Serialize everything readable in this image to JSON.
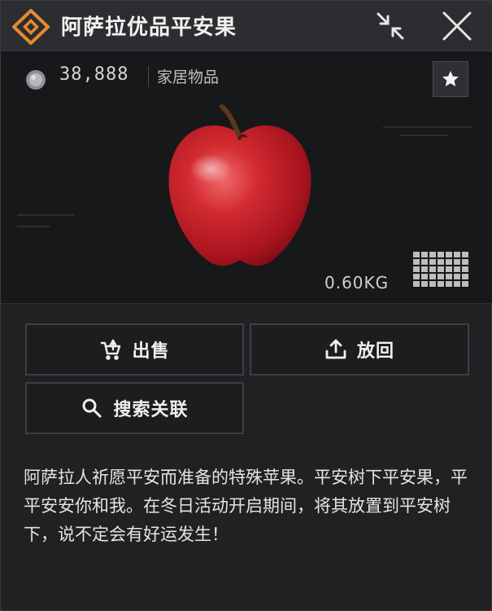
{
  "header": {
    "title": "阿萨拉优品平安果",
    "collapse_icon": "collapse-arrows-icon",
    "close_icon": "close-icon",
    "logo_icon": "diamond-logo-icon"
  },
  "item": {
    "price": "38,888",
    "currency_icon": "coin-icon",
    "category": "家居物品",
    "favorite_icon": "star-icon",
    "image": "red-apple",
    "weight": "0.60KG",
    "size_icon": "grid-size-icon"
  },
  "actions": {
    "sell_label": "出售",
    "return_label": "放回",
    "search_label": "搜索关联"
  },
  "description": "阿萨拉人祈愿平安而准备的特殊苹果。平安树下平安果，平平安安你和我。在冬日活动开启期间，将其放置到平安树下，说不定会有好运发生！",
  "colors": {
    "logo_orange": "#e58a2f",
    "apple_red": "#c8232c",
    "panel_bg": "#202123"
  }
}
